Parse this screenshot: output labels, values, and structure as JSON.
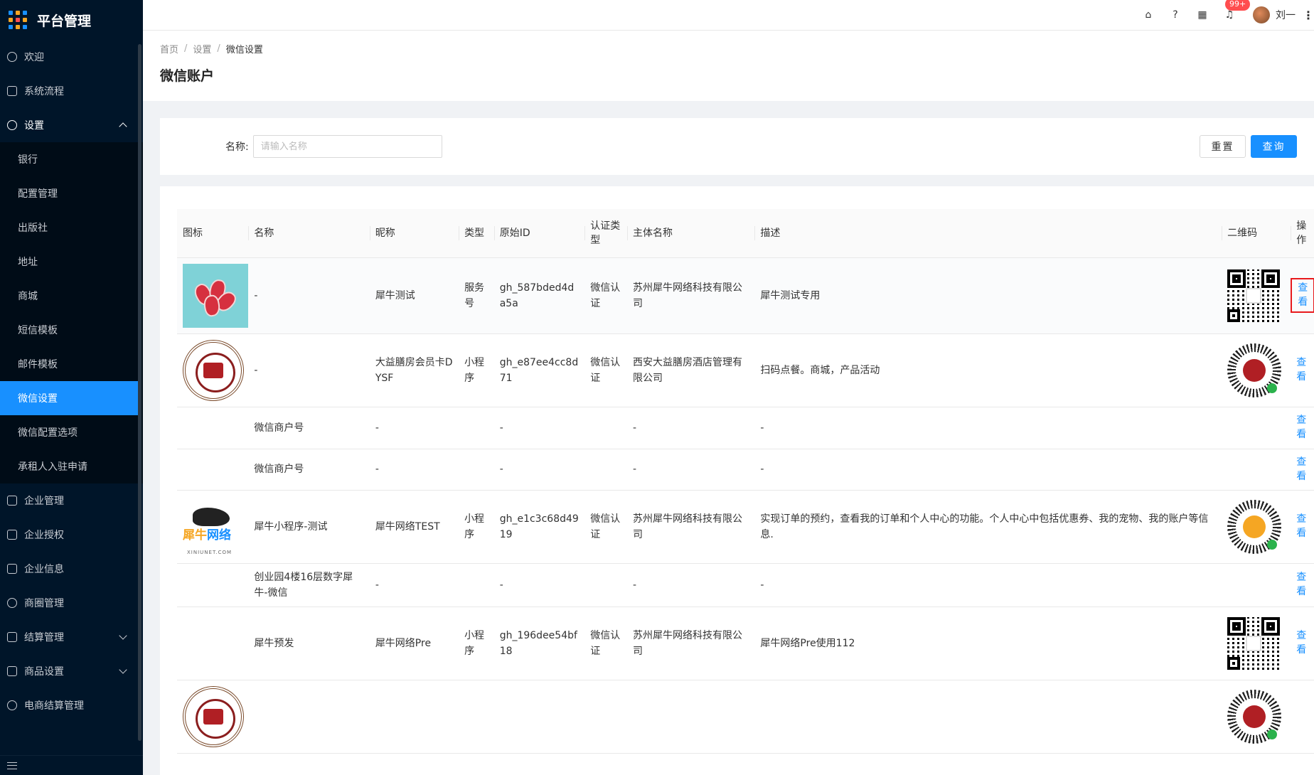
{
  "app": {
    "title": "平台管理"
  },
  "sidebar": {
    "items_top": [
      {
        "label": "欢迎",
        "icon": "smile-icon"
      },
      {
        "label": "系统流程",
        "icon": "mail-icon"
      },
      {
        "label": "设置",
        "icon": "gear-icon"
      }
    ],
    "settings_sub": [
      {
        "label": "银行"
      },
      {
        "label": "配置管理"
      },
      {
        "label": "出版社"
      },
      {
        "label": "地址"
      },
      {
        "label": "商城"
      },
      {
        "label": "短信模板"
      },
      {
        "label": "邮件模板"
      },
      {
        "label": "微信设置"
      },
      {
        "label": "微信配置选项"
      },
      {
        "label": "承租人入驻申请"
      }
    ],
    "items_bottom": [
      {
        "label": "企业管理"
      },
      {
        "label": "企业授权"
      },
      {
        "label": "企业信息"
      },
      {
        "label": "商圈管理"
      },
      {
        "label": "结算管理"
      },
      {
        "label": "商品设置"
      },
      {
        "label": "电商结算管理"
      }
    ]
  },
  "header": {
    "badge": "99+",
    "username": "刘一",
    "icons": [
      "home-icon",
      "help-icon",
      "apps-icon",
      "bell-icon",
      "more-icon"
    ]
  },
  "breadcrumb": {
    "home": "首页",
    "settings": "设置",
    "current": "微信设置"
  },
  "page": {
    "title": "微信账户"
  },
  "search": {
    "label": "名称:",
    "placeholder": "请输入名称",
    "reset": "重置",
    "query": "查询"
  },
  "table": {
    "columns": {
      "icon": "图标",
      "name": "名称",
      "nickname": "昵称",
      "type": "类型",
      "orig_id": "原始ID",
      "auth_type": "认证类型",
      "entity": "主体名称",
      "desc": "描述",
      "qrcode": "二维码",
      "op": "操作"
    },
    "op_label": "查看",
    "rows": [
      {
        "icon": "meat",
        "name": "-",
        "nickname": "犀牛测试",
        "type": "服务号",
        "orig_id": "gh_587bded4da5a",
        "auth_type": "微信认证",
        "entity": "苏州犀牛网络科技有限公司",
        "desc": "犀牛测试专用",
        "qr": "qr"
      },
      {
        "icon": "seal",
        "name": "-",
        "nickname": "大益膳房会员卡DYSF",
        "type": "小程序",
        "orig_id": "gh_e87ee4cc8d71",
        "auth_type": "微信认证",
        "entity": "西安大益膳房酒店管理有限公司",
        "desc": "扫码点餐。商城，产品活动",
        "qr": "mini"
      },
      {
        "icon": "",
        "name": "微信商户号",
        "nickname": "-",
        "type": "",
        "orig_id": "-",
        "auth_type": "",
        "entity": "-",
        "desc": "-",
        "qr": ""
      },
      {
        "icon": "",
        "name": "微信商户号",
        "nickname": "-",
        "type": "",
        "orig_id": "-",
        "auth_type": "",
        "entity": "-",
        "desc": "-",
        "qr": ""
      },
      {
        "icon": "rhino",
        "name": "犀牛小程序-测试",
        "nickname": "犀牛网络TEST",
        "type": "小程序",
        "orig_id": "gh_e1c3c68d4919",
        "auth_type": "微信认证",
        "entity": "苏州犀牛网络科技有限公司",
        "desc": "实现订单的预约，查看我的订单和个人中心的功能。个人中心中包括优惠券、我的宠物、我的账户等信息.",
        "qr": "mini-rh"
      },
      {
        "icon": "",
        "name": "创业园4楼16层数字犀牛-微信",
        "nickname": "-",
        "type": "",
        "orig_id": "-",
        "auth_type": "",
        "entity": "-",
        "desc": "-",
        "qr": ""
      },
      {
        "icon": "",
        "name": "犀牛预发",
        "nickname": "犀牛网络Pre",
        "type": "小程序",
        "orig_id": "gh_196dee54bf18",
        "auth_type": "微信认证",
        "entity": "苏州犀牛网络科技有限公司",
        "desc": "犀牛网络Pre使用112",
        "qr": "qr"
      }
    ]
  },
  "logo_text": {
    "rhino_a": "犀牛",
    "rhino_b": "网络",
    "rhino_sub": "XINIUNET.COM"
  }
}
